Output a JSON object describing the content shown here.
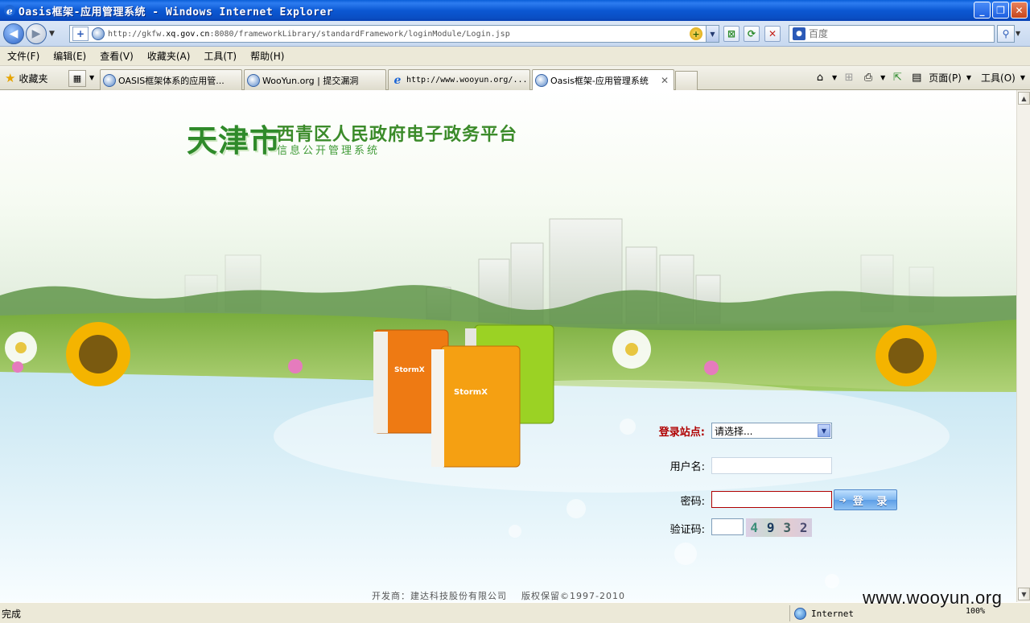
{
  "window": {
    "title": "Oasis框架-应用管理系统 - Windows Internet Explorer",
    "buttons": {
      "minimize": "_",
      "restore": "❐",
      "close": "✕"
    }
  },
  "address_bar": {
    "url_prefix": "http://gkfw.",
    "url_domain": "xq.gov.cn",
    "url_suffix": ":8080/frameworkLibrary/standardFramework/loginModule/Login.jsp"
  },
  "search": {
    "placeholder": "百度",
    "provider_icon": "baidu-paw-icon"
  },
  "menu": {
    "items": [
      "文件(F)",
      "编辑(E)",
      "查看(V)",
      "收藏夹(A)",
      "工具(T)",
      "帮助(H)"
    ]
  },
  "favorites": {
    "label": "收藏夹"
  },
  "tabs": [
    {
      "label": "OASIS框架体系的应用管...",
      "icon": "oasis-icon",
      "active": false
    },
    {
      "label": "WooYun.org | 提交漏洞",
      "icon": "oasis-icon",
      "active": false
    },
    {
      "label": "http://www.wooyun.org/...",
      "icon": "ie-icon",
      "active": false
    },
    {
      "label": "Oasis框架-应用管理系统",
      "icon": "oasis-icon",
      "active": true
    }
  ],
  "command_bar": {
    "page_label": "页面(P)",
    "tools_label": "工具(O)"
  },
  "page": {
    "logo_city": "天津市",
    "logo_title": "西青区人民政府电子政务平台",
    "logo_subtitle": "信息公开管理系统",
    "login": {
      "site_label": "登录站点:",
      "site_selected": "请选择...",
      "username_label": "用户名:",
      "password_label": "密码:",
      "captcha_label": "验证码:",
      "login_button": "登 录",
      "captcha_digits": [
        "4",
        "9",
        "3",
        "2"
      ]
    },
    "footer": "开发商：建达科技股份有限公司    版权保留©1997-2010"
  },
  "status": {
    "text": "完成",
    "zone": "Internet",
    "zoom": "100%"
  },
  "watermark": "www.wooyun.org",
  "colors": {
    "titlebar": "#0a58d3",
    "logo_green": "#2f8a2a",
    "site_label_red": "#b00000"
  }
}
